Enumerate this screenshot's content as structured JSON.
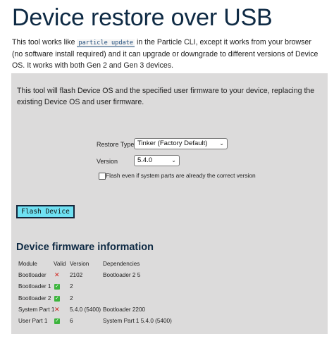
{
  "page": {
    "title": "Device restore over USB",
    "intro_before": "This tool works like ",
    "intro_code": "particle update",
    "intro_after": " in the Particle CLI, except it works from your browser (no software install required) and it can upgrade or downgrade to different versions of Device OS. It works with both Gen 2 and Gen 3 devices."
  },
  "panel": {
    "description": "This tool will flash Device OS and the specified user firmware to your device, replacing the existing Device OS and user firmware.",
    "restore_type_label": "Restore Type",
    "restore_type_value": "Tinker (Factory Default)",
    "version_label": "Version",
    "version_value": "5.4.0",
    "force_checkbox_label": "Flash even if system parts are already the correct version",
    "force_checked": false,
    "flash_button": "Flash Device"
  },
  "firmware": {
    "heading": "Device firmware information",
    "columns": [
      "Module",
      "Valid",
      "Version",
      "Dependencies"
    ],
    "rows": [
      {
        "module": "Bootloader",
        "valid": false,
        "version": "2102",
        "dependencies": "Bootloader 2 5"
      },
      {
        "module": "Bootloader 1",
        "valid": true,
        "version": "2",
        "dependencies": ""
      },
      {
        "module": "Bootloader 2",
        "valid": true,
        "version": "2",
        "dependencies": ""
      },
      {
        "module": "System Part 1",
        "valid": false,
        "version": "5.4.0 (5400)",
        "dependencies": "Bootloader 2200"
      },
      {
        "module": "User Part 1",
        "valid": true,
        "version": "6",
        "dependencies": "System Part 1 5.4.0 (5400)"
      }
    ]
  },
  "colors": {
    "title": "#0e2a44",
    "panel_bg": "#dcdbdb",
    "button_bg": "#6fe0f2",
    "invalid": "#d0201a",
    "valid": "#3cb43c"
  },
  "icons": {
    "invalid": "x-mark-icon",
    "valid": "check-mark-icon",
    "select": "chevron-down-icon"
  }
}
